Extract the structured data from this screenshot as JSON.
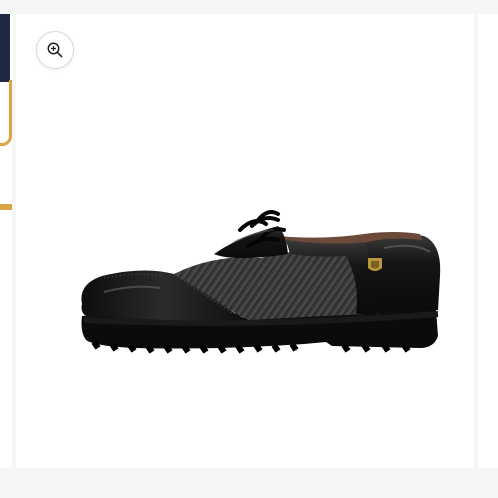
{
  "gallery": {
    "zoom_button": {
      "icon": "zoom-in-icon",
      "accessible_label": ""
    },
    "image": {
      "subject": "",
      "colors": {
        "leather": "#141414",
        "tweed": "#3a3a3a",
        "sole": "#0e0e0e",
        "welt_stripe": "#c9b27a",
        "lining": "#6b4a3a",
        "badge": "#b8963e"
      }
    }
  }
}
